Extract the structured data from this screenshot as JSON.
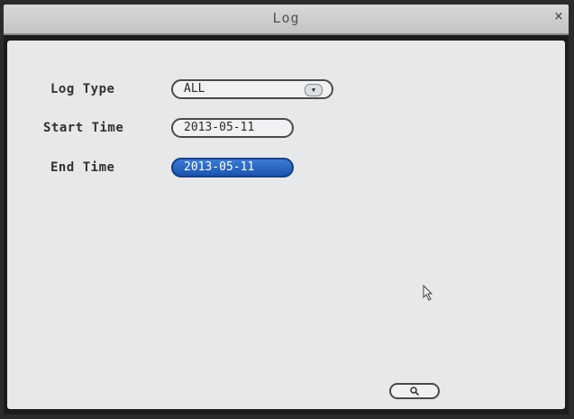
{
  "window": {
    "title": "Log",
    "close_glyph": "×"
  },
  "form": {
    "log_type": {
      "label": "Log Type",
      "value": "ALL",
      "icon": "chevron-down-icon"
    },
    "start_time": {
      "label": "Start Time",
      "value": "2013-05-11"
    },
    "end_time": {
      "label": "End Time",
      "value": "2013-05-11",
      "selected": true
    }
  },
  "search_button": {
    "icon": "search-icon"
  },
  "colors": {
    "panel_bg": "#e6e8ea",
    "selected_field": "#2a66c4",
    "frame": "#1c1c1c"
  }
}
